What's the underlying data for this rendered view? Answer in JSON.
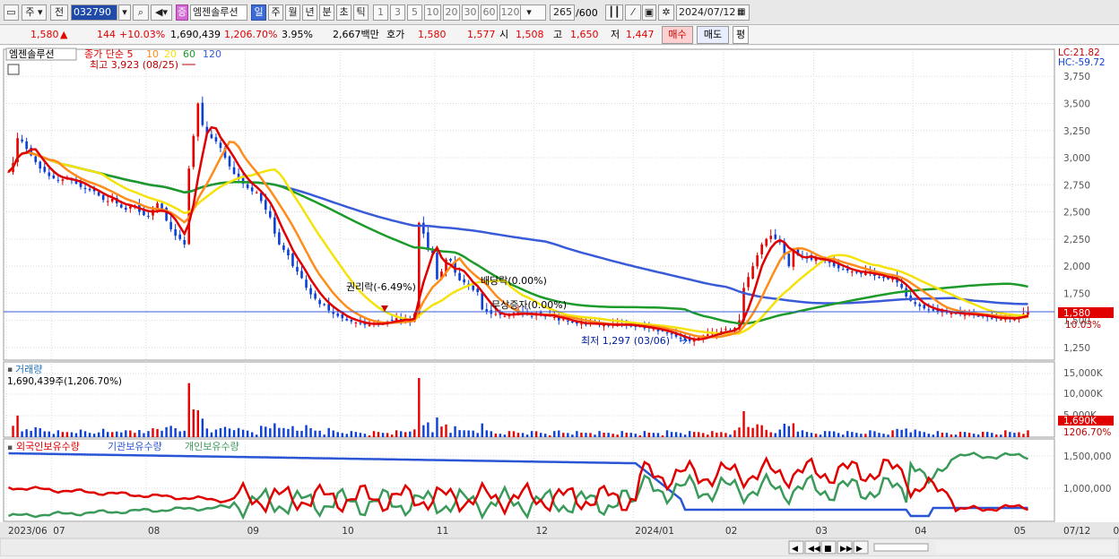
{
  "toolbar": {
    "market": "주",
    "prev": "전",
    "code": "032790",
    "stock_name": "엠젠솔루션",
    "badge": "증",
    "periods": [
      "일",
      "주",
      "월",
      "년",
      "분",
      "초",
      "틱"
    ],
    "active_period": "일",
    "intervals": [
      "1",
      "3",
      "5",
      "10",
      "20",
      "30",
      "60",
      "120"
    ],
    "count": "265",
    "count_total": "/600",
    "date": "2024/07/12"
  },
  "info": {
    "price": "1,580",
    "arrow": "▲",
    "change": "144",
    "change_pct": "+10.03%",
    "volume": "1,690,439",
    "volume_pct": "1,206.70%",
    "turnover": "3.95%",
    "amount": "2,667백만",
    "bid_label": "호가",
    "bid": "1,580",
    "ask": "1,577",
    "open_label": "시",
    "open": "1,508",
    "high_label": "고",
    "high": "1,650",
    "low_label": "저",
    "low": "1,447",
    "buy_btn": "매수",
    "sell_btn": "매도",
    "eval_btn": "평"
  },
  "chart_data": [
    {
      "type": "candlestick",
      "title": "엠젠솔루션",
      "legend": [
        "종가 단순 5",
        "10",
        "20",
        "60",
        "120"
      ],
      "colors": {
        "up": "#e60000",
        "down": "#0a3fd8",
        "ma5": "#e00000",
        "ma10": "#ff8c1a",
        "ma20": "#f5e20a",
        "ma60": "#1c9a2a",
        "ma120": "#3a5bd9"
      },
      "ylim": [
        1150,
        3950
      ],
      "yticks": [
        1250,
        1500,
        1750,
        2000,
        2250,
        2500,
        2750,
        3000,
        3250,
        3500,
        3750
      ],
      "ytick_labels": [
        "1,250",
        "1,500",
        "1,750",
        "2,000",
        "2,250",
        "2,500",
        "2,750",
        "3,000",
        "3,250",
        "3,500",
        "3,750"
      ],
      "lc": "LC:21.82",
      "hc": "HC:-59.72",
      "current_price_label": "1,580",
      "current_pct_label": "10.03%",
      "annotations": {
        "high": "최고 3,923 (08/25)",
        "low": "최저 1,297 (03/06)",
        "rights": "권리락(-6.49%)",
        "dividend": "배당락(0.00%)",
        "bonus": "무상증자(0.00%)"
      },
      "x_labels": [
        "2023/06",
        "07",
        "08",
        "09",
        "10",
        "11",
        "12",
        "2024/01",
        "02",
        "03",
        "04",
        "05",
        "06",
        "07",
        "07/12"
      ],
      "close": [
        2870,
        2950,
        3180,
        3150,
        3080,
        3020,
        2960,
        2900,
        2870,
        2830,
        2810,
        2790,
        2800,
        2820,
        2790,
        2760,
        2730,
        2710,
        2700,
        2690,
        2650,
        2610,
        2600,
        2620,
        2580,
        2540,
        2520,
        2550,
        2560,
        2500,
        2470,
        2460,
        2520,
        2580,
        2530,
        2420,
        2340,
        2280,
        2250,
        2200,
        2900,
        3200,
        3500,
        3300,
        3220,
        3180,
        3150,
        3090,
        3000,
        2920,
        2850,
        2800,
        2760,
        2720,
        2690,
        2680,
        2600,
        2520,
        2450,
        2300,
        2200,
        2150,
        2100,
        2000,
        1950,
        1890,
        1800,
        1740,
        1700,
        1650,
        1640,
        1590,
        1560,
        1540,
        1520,
        1500,
        1490,
        1480,
        1470,
        1460,
        1460,
        1470,
        1480,
        1470,
        1490,
        1500,
        1520,
        1500,
        1520,
        1480,
        1560,
        2400,
        2300,
        2150,
        2120,
        1880,
        1950,
        2060,
        2050,
        1940,
        1870,
        1850,
        1820,
        1780,
        1760,
        1600,
        1580,
        1560,
        1560,
        1550,
        1540,
        1550,
        1570,
        1580,
        1560,
        1550,
        1540,
        1560,
        1550,
        1540,
        1540,
        1530,
        1500,
        1510,
        1490,
        1480,
        1470,
        1470,
        1460,
        1480,
        1470,
        1460,
        1460,
        1450,
        1460,
        1470,
        1460,
        1460,
        1450,
        1440,
        1440,
        1430,
        1430,
        1420,
        1400,
        1400,
        1380,
        1370,
        1350,
        1330,
        1320,
        1310,
        1320,
        1340,
        1360,
        1370,
        1380,
        1380,
        1400,
        1420,
        1410,
        1430,
        1500,
        1800,
        1900,
        2000,
        2100,
        2200,
        2250,
        2280,
        2250,
        2220,
        2100,
        2000,
        2150,
        2100,
        2080,
        2070,
        2060,
        2070,
        2060,
        2050,
        2030,
        2000,
        1980,
        1970,
        1960,
        1950,
        1940,
        1930,
        1950,
        1930,
        1910,
        1900,
        1890,
        1880,
        1900,
        1850,
        1800,
        1720,
        1680,
        1650,
        1630,
        1610,
        1600,
        1590,
        1580,
        1580,
        1570,
        1570,
        1560,
        1560,
        1550,
        1560,
        1550,
        1540,
        1540,
        1530,
        1520,
        1520,
        1510,
        1530,
        1520,
        1510,
        1540,
        1560,
        1580
      ],
      "volume_axis": {
        "ticks": [
          "15,000K",
          "10,000K",
          "5,000K"
        ],
        "current": "1,690K",
        "current_pct": "1206.70%"
      },
      "volume_label": "거래량",
      "volume_sub": "1,690,439주(1,206.70%)",
      "holding_legend": [
        "외국인보유수량",
        "기관보유수량",
        "개인보유수량"
      ],
      "holding_colors": [
        "#e00000",
        "#2a56d6",
        "#3a9a5a"
      ],
      "holding_axis": [
        "1,500,000",
        "1,000,000"
      ]
    }
  ],
  "bottom_controls": [
    "◀",
    "◀◀",
    "■",
    "▶▶",
    "▶"
  ]
}
